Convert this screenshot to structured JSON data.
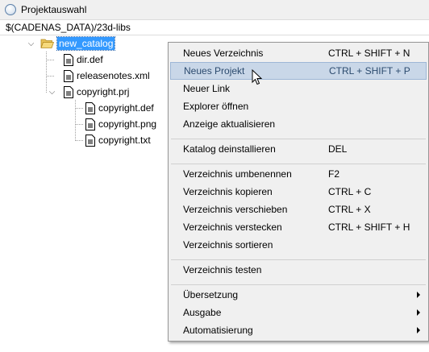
{
  "window": {
    "title": "Projektauswahl"
  },
  "path": "$(CADENAS_DATA)/23d-libs",
  "tree": {
    "root": {
      "label": "new_catalog",
      "selected": true
    },
    "children": [
      {
        "label": "dir.def"
      },
      {
        "label": "releasenotes.xml"
      },
      {
        "label": "copyright.prj"
      }
    ],
    "prj_children": [
      {
        "label": "copyright.def"
      },
      {
        "label": "copyright.png"
      },
      {
        "label": "copyright.txt"
      }
    ]
  },
  "context_menu": {
    "items": [
      {
        "label": "Neues Verzeichnis",
        "shortcut": "CTRL + SHIFT + N"
      },
      {
        "label": "Neues Projekt",
        "shortcut": "CTRL + SHIFT + P",
        "highlighted": true
      },
      {
        "label": "Neuer Link",
        "shortcut": ""
      },
      {
        "label": "Explorer öffnen",
        "shortcut": ""
      },
      {
        "label": "Anzeige aktualisieren",
        "shortcut": ""
      },
      {
        "label": "Katalog deinstallieren",
        "shortcut": "DEL"
      },
      {
        "label": "Verzeichnis umbenennen",
        "shortcut": "F2"
      },
      {
        "label": "Verzeichnis kopieren",
        "shortcut": "CTRL + C"
      },
      {
        "label": "Verzeichnis verschieben",
        "shortcut": "CTRL + X"
      },
      {
        "label": "Verzeichnis verstecken",
        "shortcut": "CTRL + SHIFT + H"
      },
      {
        "label": "Verzeichnis sortieren",
        "shortcut": ""
      },
      {
        "label": "Verzeichnis testen",
        "shortcut": ""
      },
      {
        "label": "Übersetzung",
        "submenu": true
      },
      {
        "label": "Ausgabe",
        "submenu": true
      },
      {
        "label": "Automatisierung",
        "submenu": true
      }
    ]
  },
  "colors": {
    "selection": "#3399ff",
    "menu_bg": "#f0f0f0",
    "menu_hover": "#c9d7e8"
  }
}
